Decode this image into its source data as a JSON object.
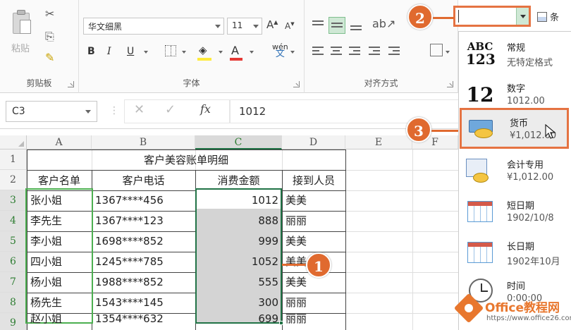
{
  "ribbon": {
    "clipboard": {
      "paste_label": "粘贴",
      "group_label": "剪贴板"
    },
    "font": {
      "font_name": "华文细黑",
      "font_size": "11",
      "grow_label": "A",
      "shrink_label": "A",
      "bold_label": "B",
      "italic_label": "I",
      "underline_label": "U",
      "wen_label": "wén",
      "wen_char": "文",
      "group_label": "字体"
    },
    "alignment": {
      "group_label": "对齐方式"
    }
  },
  "formula_bar": {
    "name_box": "C3",
    "fx_label": "fx",
    "content": "1012"
  },
  "grid": {
    "columns": [
      "A",
      "B",
      "C",
      "D",
      "E",
      "F"
    ],
    "rows": [
      "1",
      "2",
      "3",
      "4",
      "5",
      "6",
      "7",
      "8",
      "9"
    ],
    "title": "客户美容账单明细",
    "headers": [
      "客户名单",
      "客户电话",
      "消费金额",
      "接到人员"
    ],
    "records": [
      {
        "name": "张小姐",
        "phone": "1367****456",
        "amount": "1012",
        "staff": "美美"
      },
      {
        "name": "李先生",
        "phone": "1367****123",
        "amount": "888",
        "staff": "丽丽"
      },
      {
        "name": "李小姐",
        "phone": "1698****852",
        "amount": "999",
        "staff": "美美"
      },
      {
        "name": "四小姐",
        "phone": "1245****785",
        "amount": "1052",
        "staff": "美美"
      },
      {
        "name": "杨小姐",
        "phone": "1988****852",
        "amount": "555",
        "staff": "美美"
      },
      {
        "name": "杨先生",
        "phone": "1543****145",
        "amount": "300",
        "staff": "丽丽"
      },
      {
        "name": "赵小姐",
        "phone": "1354****632",
        "amount": "699",
        "staff": "丽丽"
      }
    ]
  },
  "number_format": {
    "combo_value": "",
    "conditional_label": "条",
    "items": [
      {
        "title": "常规",
        "sample": "无特定格式",
        "icon": "abc-123-icon",
        "icon_top": "ABC",
        "icon_bottom": "123"
      },
      {
        "title": "数字",
        "sample": "1012.00",
        "icon": "number-12-icon",
        "icon_text": "12"
      },
      {
        "title": "货币",
        "sample": "¥1,012.00",
        "icon": "currency-icon"
      },
      {
        "title": "会计专用",
        "sample": "¥1,012.00",
        "icon": "accounting-icon"
      },
      {
        "title": "短日期",
        "sample": "1902/10/8",
        "icon": "calendar-icon"
      },
      {
        "title": "长日期",
        "sample": "1902年10月",
        "icon": "calendar-icon"
      },
      {
        "title": "时间",
        "sample": "0:00:00",
        "icon": "clock-icon"
      }
    ]
  },
  "callouts": [
    "1",
    "2",
    "3"
  ],
  "watermark": {
    "brand": "Office教程网",
    "url": "https://www.office26.com"
  },
  "colors": {
    "accent_green": "#217346",
    "callout": "#e06a2f",
    "selection": "#d4d4d4"
  }
}
